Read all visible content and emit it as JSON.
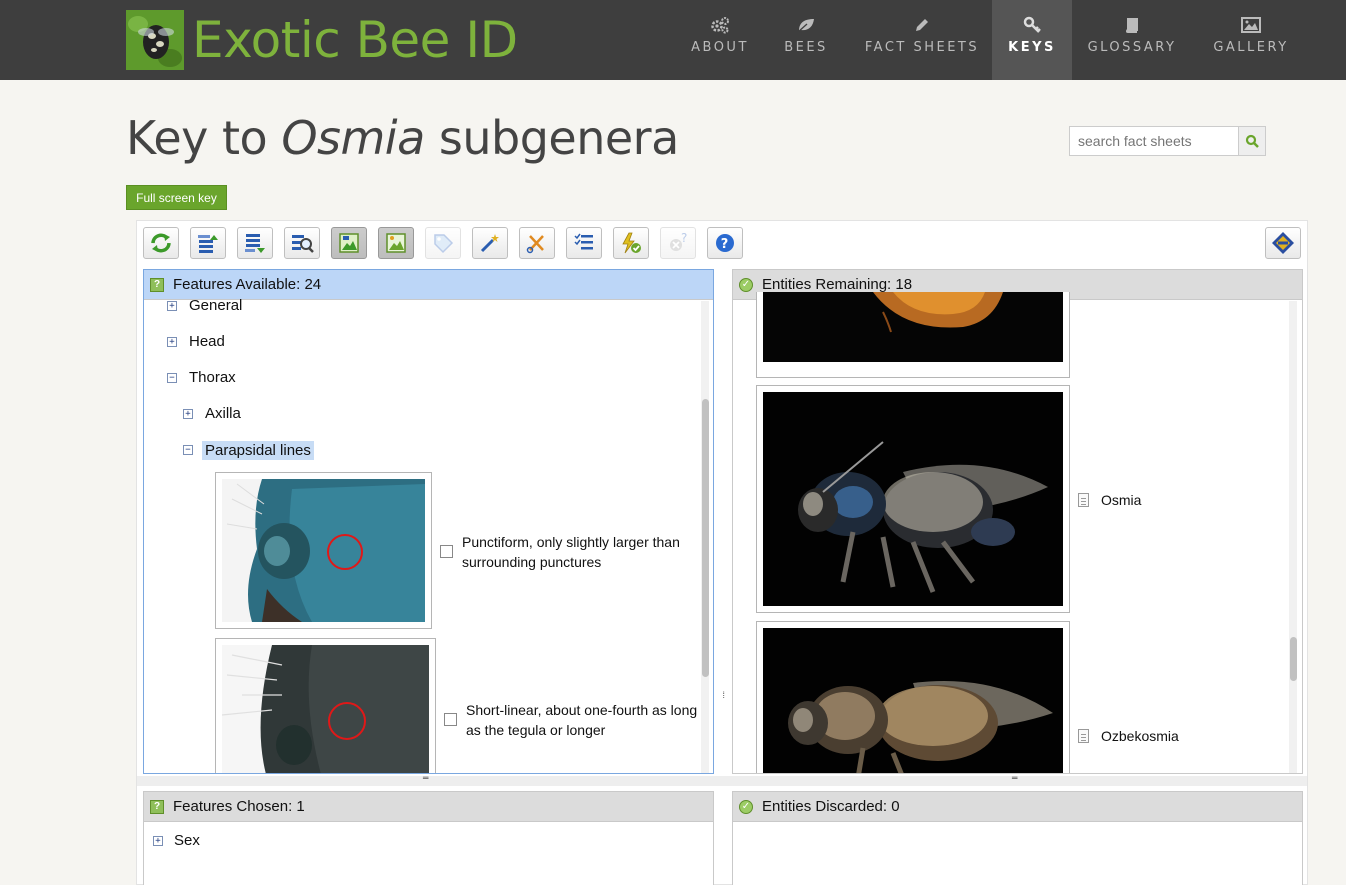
{
  "header": {
    "site_title": "Exotic Bee ID",
    "nav": [
      {
        "label": "ABOUT",
        "icon": "gears-icon"
      },
      {
        "label": "BEES",
        "icon": "leaf-icon"
      },
      {
        "label": "FACT SHEETS",
        "icon": "pencil-icon"
      },
      {
        "label": "KEYS",
        "icon": "key-icon",
        "active": true
      },
      {
        "label": "GLOSSARY",
        "icon": "book-icon"
      },
      {
        "label": "GALLERY",
        "icon": "picture-icon"
      }
    ]
  },
  "page": {
    "title_prefix": "Key to ",
    "title_italic": "Osmia",
    "title_suffix": " subgenera",
    "search_placeholder": "search fact sheets",
    "fullscreen_label": "Full screen key"
  },
  "toolbar": {
    "buttons": [
      "restart-icon",
      "move-up-icon",
      "move-down-icon",
      "find-icon",
      "image-view-icon",
      "image-toggle-icon",
      "tag-icon",
      "magic-wand-icon",
      "scissors-icon",
      "checklist-icon",
      "lightning-check-icon",
      "help-disabled-icon",
      "help-icon"
    ],
    "right_button": "lucid-logo-icon"
  },
  "features_available": {
    "header": "Features Available: 24",
    "tree": {
      "general": "General",
      "head": "Head",
      "thorax": "Thorax",
      "axilla": "Axilla",
      "parapsidal": "Parapsidal lines"
    },
    "options": [
      {
        "text": "Punctiform, only slightly larger than surrounding punctures"
      },
      {
        "text": "Short-linear, about one-fourth as long as the tegula or longer"
      }
    ]
  },
  "entities_remaining": {
    "header": "Entities Remaining: 18",
    "items": [
      {
        "name": "Osmia"
      },
      {
        "name": "Ozbekosmia"
      }
    ]
  },
  "features_chosen": {
    "header": "Features Chosen: 1",
    "items": [
      {
        "label": "Sex"
      }
    ]
  },
  "entities_discarded": {
    "header": "Entities Discarded: 0"
  },
  "colors": {
    "brand_green": "#7eb23c",
    "topbar": "#3e3e3e",
    "selected_blue": "#bcd6f7"
  }
}
